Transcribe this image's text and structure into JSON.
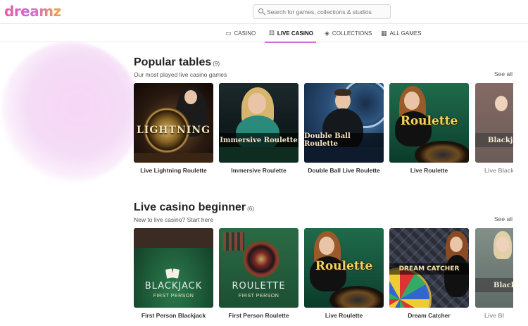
{
  "brand": {
    "logo_text": "dreamz"
  },
  "search": {
    "placeholder": "Search for games, collections & studios"
  },
  "nav": {
    "tabs": [
      {
        "label": "CASINO",
        "icon": "slot-machine-icon"
      },
      {
        "label": "LIVE CASINO",
        "icon": "dice-icon",
        "active": true
      },
      {
        "label": "COLLECTIONS",
        "icon": "layers-icon"
      },
      {
        "label": "ALL GAMES",
        "icon": "grid-icon"
      }
    ]
  },
  "colors": {
    "accent": "#d06cd6",
    "blob": "#f6d8f7"
  },
  "sections": [
    {
      "title": "Popular tables",
      "count": "(9)",
      "subtitle": "Our most played live casino games",
      "see_all": "See all",
      "cards": [
        {
          "label": "Live Lightning Roulette",
          "art_text": "LIGHTNING"
        },
        {
          "label": "Immersive Roulette",
          "art_text": "Immersive Roulette"
        },
        {
          "label": "Double Ball Live Roulette",
          "art_text": "Double Ball Roulette"
        },
        {
          "label": "Live Roulette",
          "art_text": "Roulette"
        },
        {
          "label": "Live Black",
          "art_text": "Blackja"
        }
      ]
    },
    {
      "title": "Live casino beginner",
      "count": "(6)",
      "subtitle": "New to live casino? Start here",
      "see_all": "See all",
      "cards": [
        {
          "label": "First Person Blackjack",
          "art_text": "BLACKJACK",
          "art_sub": "FIRST PERSON"
        },
        {
          "label": "First Person Roulette",
          "art_text": "ROULETTE",
          "art_sub": "FIRST PERSON"
        },
        {
          "label": "Live Roulette",
          "art_text": "Roulette"
        },
        {
          "label": "Dream Catcher",
          "art_text": "DREAM CATCHER"
        },
        {
          "label": "Live Bl",
          "art_text": "Black"
        }
      ]
    }
  ]
}
